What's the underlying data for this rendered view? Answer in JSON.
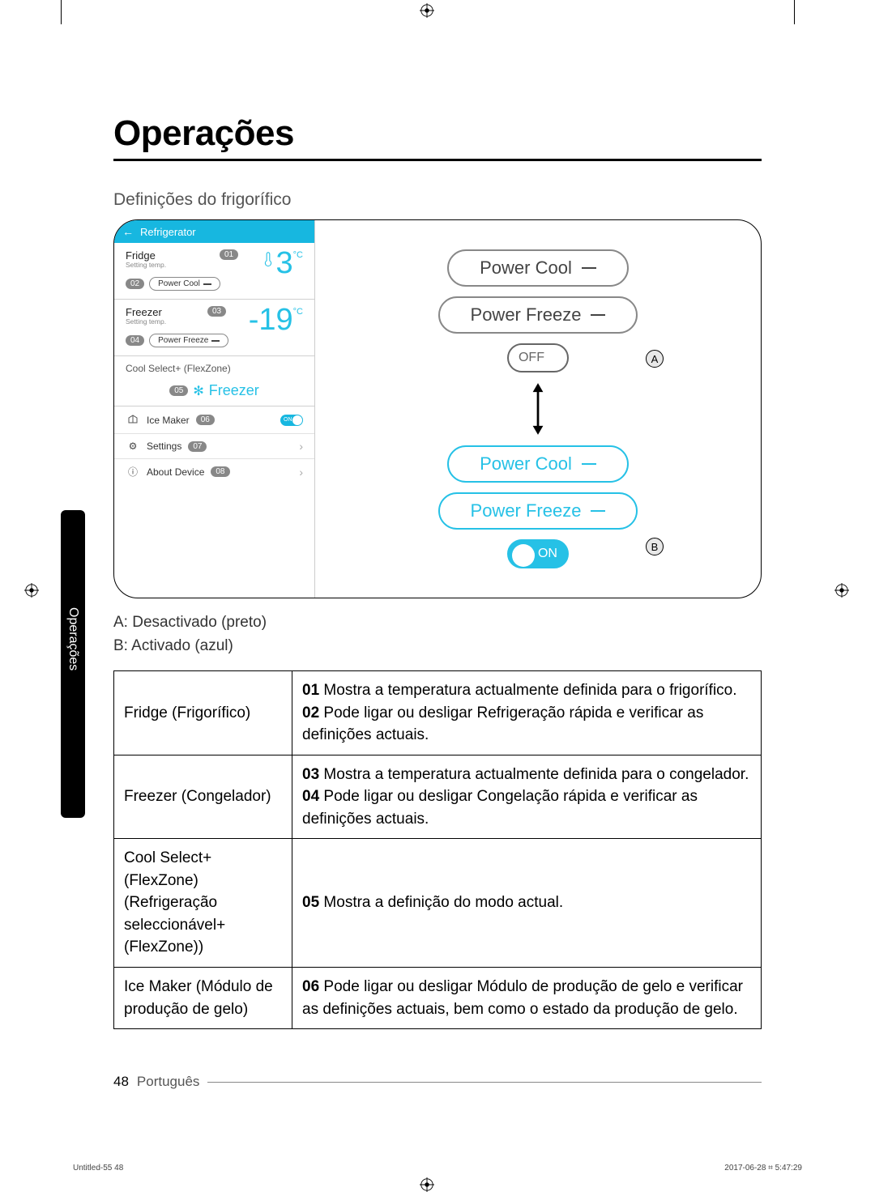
{
  "page": {
    "title": "Operações",
    "subhead": "Definições do frigorífico",
    "sidebar_tab": "Operações",
    "key_a": "A: Desactivado (preto)",
    "key_b": "B: Activado (azul)",
    "page_number": "48",
    "language": "Português",
    "print_left": "Untitled-55   48",
    "print_right": "2017-06-28   ⌗ 5:47:29"
  },
  "phone": {
    "header_back": "←",
    "header_title": "Refrigerator",
    "fridge": {
      "label": "Fridge",
      "sub": "Setting temp.",
      "badge_top": "01",
      "temp": "3",
      "unit": "°C",
      "badge_pill": "02",
      "pill_label": "Power Cool"
    },
    "freezer": {
      "label": "Freezer",
      "sub": "Setting temp.",
      "badge_top": "03",
      "temp": "-19",
      "unit": "°C",
      "badge_pill": "04",
      "pill_label": "Power Freeze"
    },
    "cool_select": {
      "label": "Cool Select+ (FlexZone)",
      "badge": "05",
      "mode": "Freezer"
    },
    "ice_maker": {
      "label": "Ice Maker",
      "badge": "06",
      "toggle": "ON"
    },
    "settings": {
      "label": "Settings",
      "badge": "07"
    },
    "about": {
      "label": "About Device",
      "badge": "08"
    }
  },
  "states": {
    "off": {
      "power_cool": "Power Cool",
      "power_freeze": "Power Freeze",
      "toggle": "OFF",
      "annot": "A"
    },
    "on": {
      "power_cool": "Power Cool",
      "power_freeze": "Power Freeze",
      "toggle": "ON",
      "annot": "B"
    }
  },
  "table": {
    "rows": [
      {
        "label": "Fridge (Frigorífico)",
        "desc": "<span class='num'>01</span> Mostra a temperatura actualmente definida para o frigorífico.<br><span class='num'>02</span> Pode ligar ou desligar Refrigeração rápida e verificar as definições actuais."
      },
      {
        "label": "Freezer (Congelador)",
        "desc": "<span class='num'>03</span> Mostra a temperatura actualmente definida para o congelador.<br><span class='num'>04</span> Pode ligar ou desligar Congelação rápida e verificar as definições actuais."
      },
      {
        "label": "Cool Select+ (FlexZone) (Refrigeração seleccionável+ (FlexZone))",
        "desc": "<span class='num'>05</span> Mostra a definição do modo actual."
      },
      {
        "label": "Ice Maker (Módulo de produção de gelo)",
        "desc": "<span class='num'>06</span> Pode ligar ou desligar Módulo de produção de gelo e verificar as definições actuais, bem como o estado da produção de gelo."
      }
    ]
  }
}
